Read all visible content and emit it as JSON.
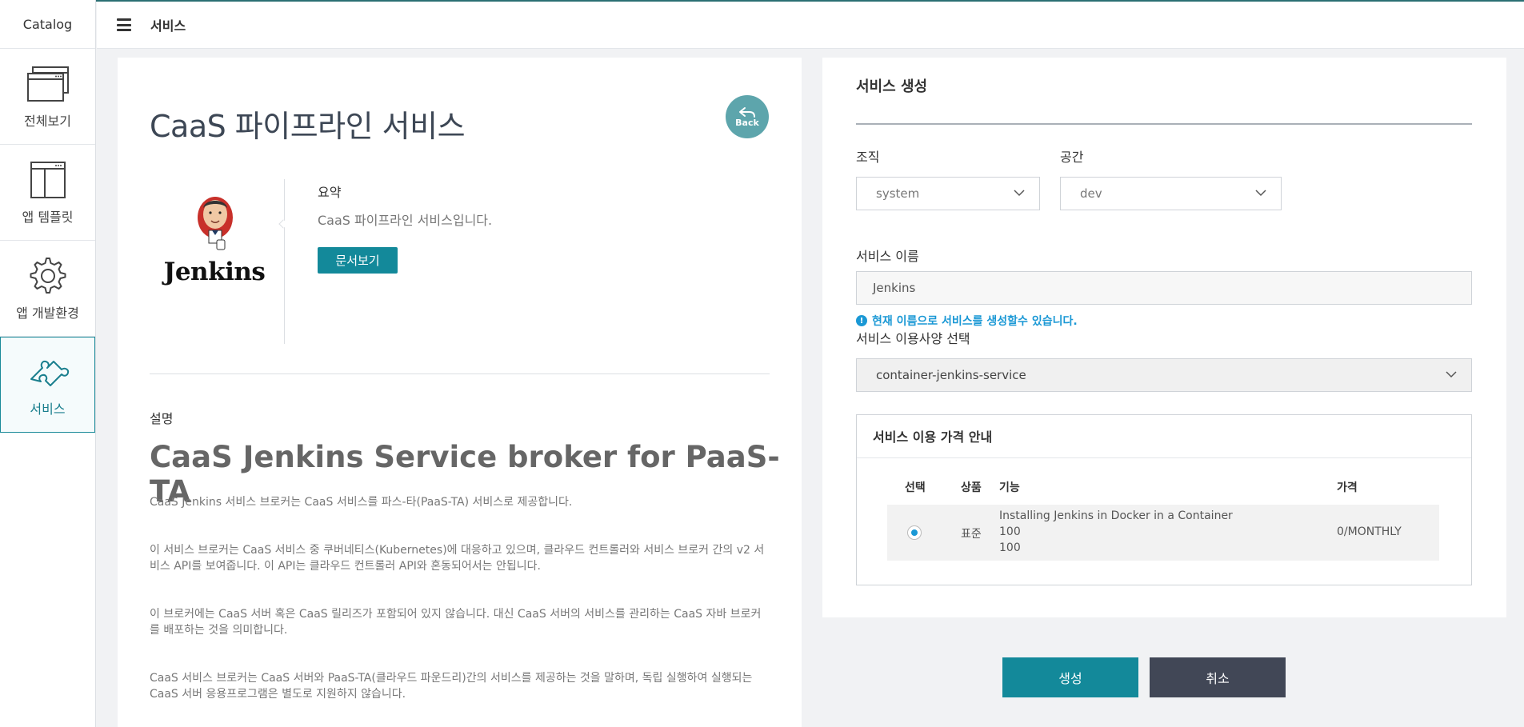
{
  "sidebar": {
    "brand": "Catalog",
    "items": [
      {
        "label": "전체보기",
        "icon": "window-icon"
      },
      {
        "label": "앱 템플릿",
        "icon": "layout-icon"
      },
      {
        "label": "앱 개발환경",
        "icon": "gear-icon"
      },
      {
        "label": "서비스",
        "icon": "puzzle-icon",
        "active": true
      }
    ]
  },
  "header": {
    "title": "서비스"
  },
  "detail": {
    "title": "CaaS 파이프라인 서비스",
    "back_label": "Back",
    "logo_text": "Jenkins",
    "summary_label": "요약",
    "summary_text": "CaaS 파이프라인 서비스입니다.",
    "docs_button": "문서보기",
    "description_label": "설명",
    "description_title": "CaaS Jenkins Service broker for PaaS-TA",
    "paragraphs": [
      "CaaS Jenkins 서비스 브로커는 CaaS 서비스를 파스-타(PaaS-TA) 서비스로 제공합니다.",
      "이 서비스 브로커는 CaaS 서비스 중 쿠버네티스(Kubernetes)에 대응하고 있으며, 클라우드 컨트롤러와 서비스 브로커 간의 v2 서비스 API를 보여줍니다. 이 API는 클라우드 컨트롤러 API와 혼동되어서는 안됩니다.",
      "이 브로커에는 CaaS 서버 혹은 CaaS 릴리즈가 포함되어 있지 않습니다. 대신 CaaS 서버의 서비스를 관리하는 CaaS 자바 브로커를 배포하는 것을 의미합니다.",
      "CaaS 서비스 브로커는 CaaS 서버와 PaaS-TA(클라우드 파운드리)간의 서비스를 제공하는 것을 말하며, 독립 실행하여 실행되는 CaaS 서버 응용프로그램은 별도로 지원하지 않습니다."
    ]
  },
  "create": {
    "title": "서비스 생성",
    "org_label": "조직",
    "org_value": "system",
    "space_label": "공간",
    "space_value": "dev",
    "name_label": "서비스 이름",
    "name_value": "Jenkins",
    "name_hint": "현재 이름으로 서비스를 생성할수 있습니다.",
    "plan_label": "서비스 이용사양 선택",
    "plan_value": "container-jenkins-service",
    "pricing": {
      "title": "서비스 이용 가격 안내",
      "headers": {
        "select": "선택",
        "product": "상품",
        "feature": "기능",
        "price": "가격"
      },
      "rows": [
        {
          "product": "표준",
          "feature_lines": [
            "Installing Jenkins in Docker in a Container",
            "100",
            "100"
          ],
          "price": "0/MONTHLY",
          "selected": true
        }
      ]
    }
  },
  "actions": {
    "create": "생성",
    "cancel": "취소"
  },
  "colors": {
    "accent": "#13899a",
    "hint": "#1a98d5",
    "cancel": "#414756",
    "back": "#5da5ac"
  }
}
